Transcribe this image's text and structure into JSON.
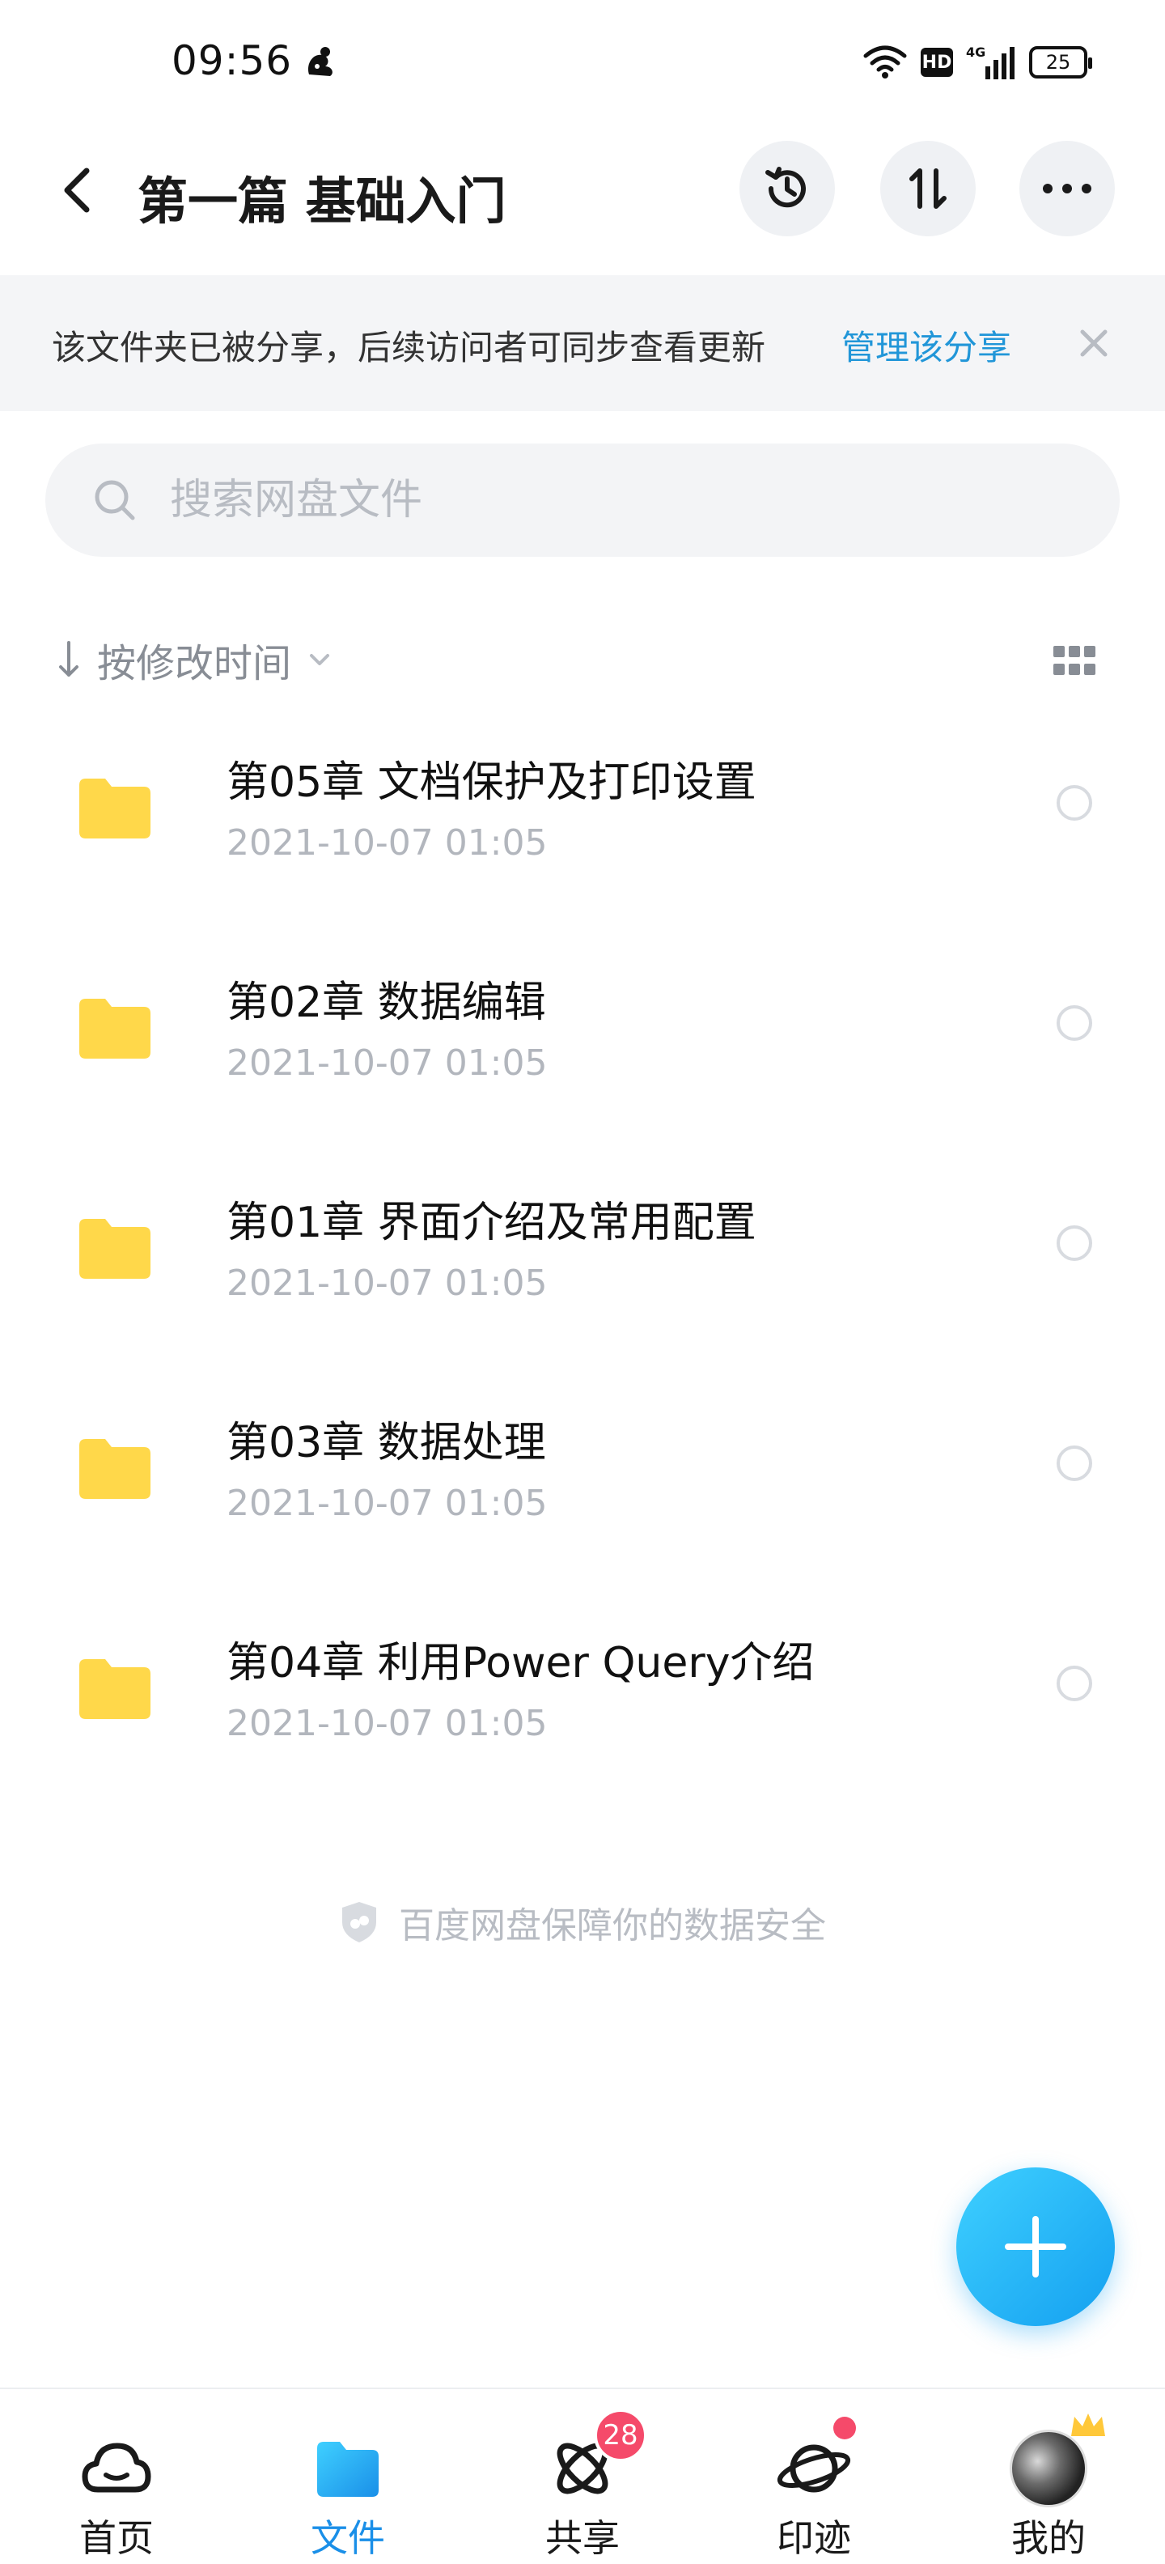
{
  "status_bar": {
    "time": "09:56",
    "network": "4G",
    "hd": "HD",
    "battery": "25"
  },
  "header": {
    "title": "第一篇 基础入门",
    "back_icon": "chevron-left-icon",
    "history_icon": "history-clock-icon",
    "transfer_icon": "transfer-arrows-icon",
    "more_icon": "more-dots-icon"
  },
  "share_banner": {
    "text": "该文件夹已被分享，后续访问者可同步查看更新",
    "link": "管理该分享",
    "link_color": "#2196d8"
  },
  "search": {
    "placeholder": "搜索网盘文件"
  },
  "sort": {
    "label": "按修改时间"
  },
  "files": [
    {
      "name": "第05章 文档保护及打印设置",
      "date": "2021-10-07  01:05"
    },
    {
      "name": "第02章 数据编辑",
      "date": "2021-10-07  01:05"
    },
    {
      "name": "第01章 界面介绍及常用配置",
      "date": "2021-10-07  01:05"
    },
    {
      "name": "第03章 数据处理",
      "date": "2021-10-07  01:05"
    },
    {
      "name": "第04章 利用Power Query介绍",
      "date": "2021-10-07  01:05"
    }
  ],
  "footer_note": "百度网盘保障你的数据安全",
  "bottom_nav": {
    "items": [
      {
        "label": "首页",
        "icon": "cloud-home-icon"
      },
      {
        "label": "文件",
        "icon": "folder-icon",
        "active": true
      },
      {
        "label": "共享",
        "icon": "atom-share-icon",
        "badge": "28"
      },
      {
        "label": "印迹",
        "icon": "planet-icon",
        "dot": true
      },
      {
        "label": "我的",
        "icon": "avatar"
      }
    ]
  },
  "colors": {
    "accent": "#1a8fe8",
    "folder": "#ffd84a",
    "badge": "#f54a6a"
  }
}
